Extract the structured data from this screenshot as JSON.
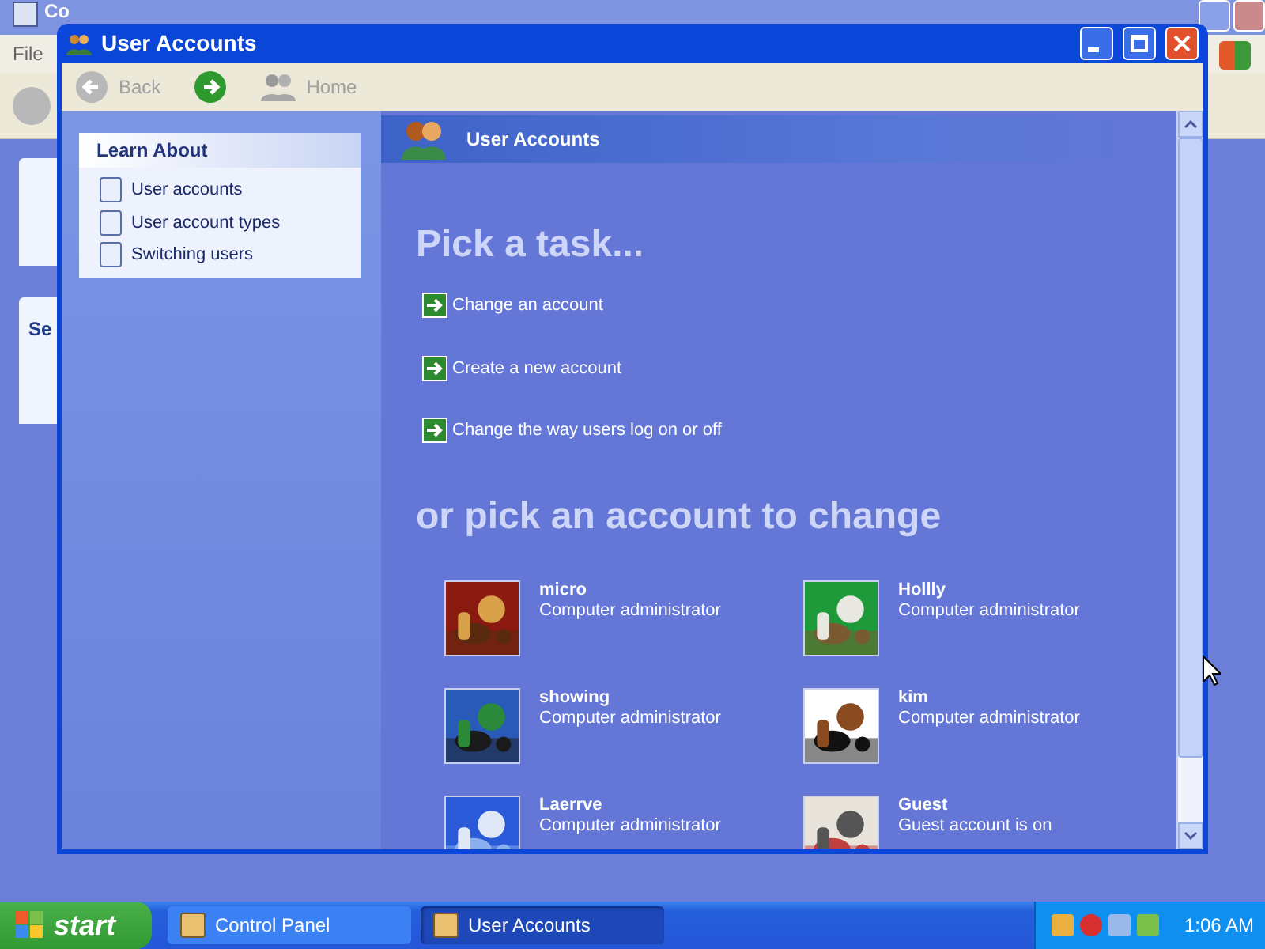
{
  "background_window": {
    "title": "Co",
    "menu": [
      "File"
    ],
    "section_heading": "Se"
  },
  "window": {
    "title": "User Accounts"
  },
  "toolbar": {
    "buttons": [
      {
        "kind": "back",
        "label": "Back",
        "disabled": true
      },
      {
        "kind": "forward",
        "disabled": false
      },
      {
        "kind": "home",
        "label": "Home",
        "disabled": true
      }
    ]
  },
  "sidebar": {
    "title": "Learn About",
    "items": [
      "User accounts",
      "User account types",
      "Switching users"
    ]
  },
  "header": {
    "title": "User Accounts"
  },
  "tasks_heading": "Pick a task...",
  "tasks": [
    "Change an account",
    "Create a new account",
    "Change the way users log on or off"
  ],
  "accounts_heading": "or pick an account to change",
  "accounts": [
    {
      "name": "micro",
      "type": "Computer administrator",
      "kind": "picture"
    },
    {
      "name": "Hollly",
      "type": "Computer administrator",
      "kind": "picture"
    },
    {
      "name": "showing",
      "type": "Computer administrator",
      "kind": "picture"
    },
    {
      "name": "kim",
      "type": "Computer administrator",
      "kind": "picture"
    },
    {
      "name": "Laerrve",
      "type": "Computer administrator",
      "kind": "picture"
    },
    {
      "name": "Guest",
      "type": "Guest account is on",
      "kind": "picture"
    }
  ],
  "taskbar": {
    "start": "start",
    "buttons": [
      {
        "label": "Control Panel",
        "selected": false
      },
      {
        "label": "User Accounts",
        "selected": true
      }
    ],
    "clock": "1:06 AM"
  }
}
